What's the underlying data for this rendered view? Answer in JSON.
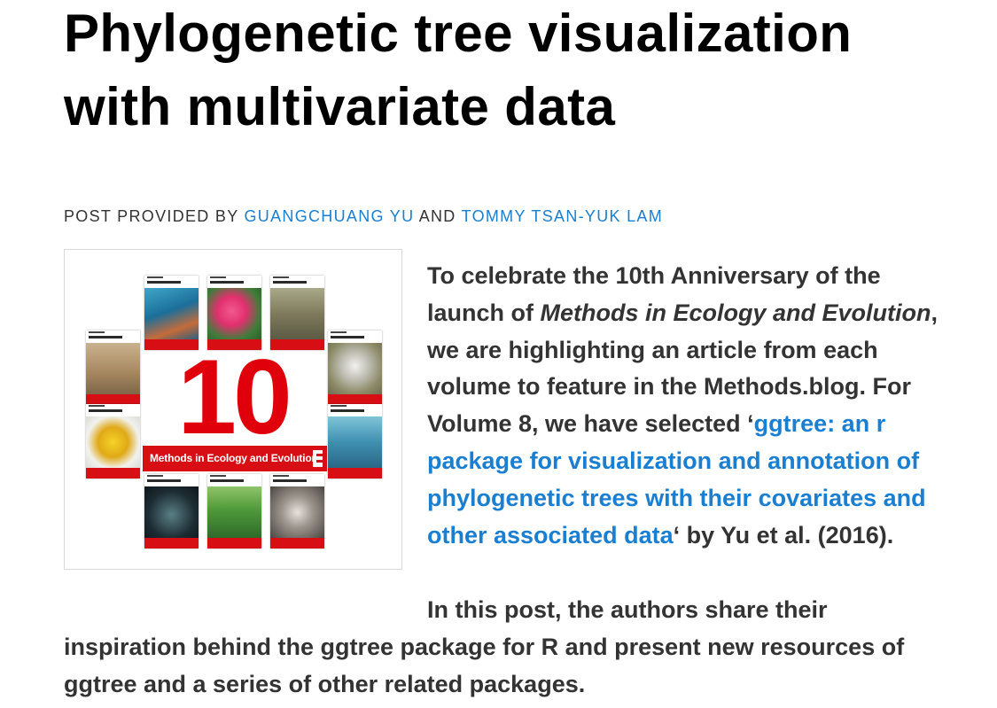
{
  "title": "Phylogenetic tree visualization with multivariate data",
  "byline": {
    "prefix": "POST PROVIDED BY",
    "author1": "GUANGCHUANG YU",
    "conjunction": "AND",
    "author2": "TOMMY TSAN-YUK LAM"
  },
  "figure": {
    "number_graphic": "10",
    "banner_text": "Methods in Ecology and Evolution"
  },
  "intro": {
    "part1": "To celebrate the 10th Anniversary of the launch of ",
    "journal_name": "Methods in Ecology and Evolution",
    "part2": ", we are highlighting an article from each volume to feature in the Methods.blog. For Volume 8, we have selected ‘",
    "article_link": "ggtree: an r package for visualization and annotation of phylogenetic trees with their covariates and other associated data",
    "part3": "‘ by Yu et al. (2016)."
  },
  "second_paragraph": "In this post, the authors share their inspiration behind the ggtree package for R and present new resources of ggtree and a series of other related packages.",
  "colors": {
    "link": "#1a7fd1",
    "text": "#333333",
    "title": "#000000",
    "accent_red": "#d70f14"
  }
}
